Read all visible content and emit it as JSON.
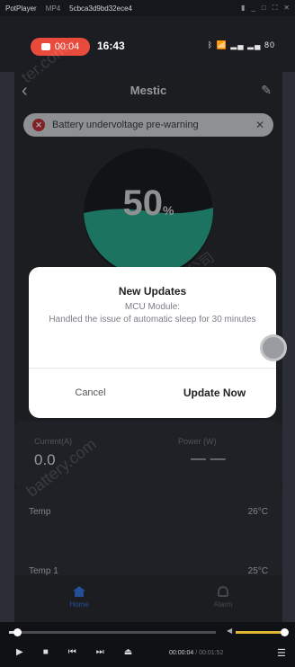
{
  "player": {
    "app_name": "PotPlayer",
    "format": "MP4",
    "file": "5cbca3d9bd32ece4",
    "window_controls": [
      "▮",
      "_",
      "□",
      "⛶",
      "✕"
    ],
    "elapsed": "00:00:04",
    "total": "/ 00:01:52",
    "progress": 0.04,
    "volume": 0.9
  },
  "status_bar": {
    "recording_time": "00:04",
    "clock": "16:43",
    "icons_text": "ᛒ 📶 ▂▄ ▂▄ 80"
  },
  "header": {
    "title": "Mestic"
  },
  "warning": {
    "text": "Battery undervoltage pre-warning"
  },
  "gauge": {
    "value": "50",
    "unit": "%",
    "fraction": 0.5,
    "fill_color": "#2bb394"
  },
  "metrics": {
    "current_label": "Current(A)",
    "current_value": "0.0",
    "power_label": "Power (W)",
    "power_value": "— —"
  },
  "temps": [
    {
      "label": "Temp",
      "value": "26°C"
    },
    {
      "label": "Temp 1",
      "value": "25°C"
    }
  ],
  "nav": {
    "home": "Home",
    "alarm": "Alarm"
  },
  "dialog": {
    "title": "New Updates",
    "line1": "MCU Module:",
    "line2": "Handled the issue of automatic sleep for 30 minutes",
    "cancel": "Cancel",
    "update": "Update Now"
  },
  "watermarks": [
    "ter.com",
    "杭州力芯科技有限公司",
    "battery.com"
  ],
  "colors": {
    "accent": "#3a7be8",
    "record": "#e84a3c",
    "gauge_fill": "#2bb394",
    "warning_icon": "#c8323a"
  }
}
